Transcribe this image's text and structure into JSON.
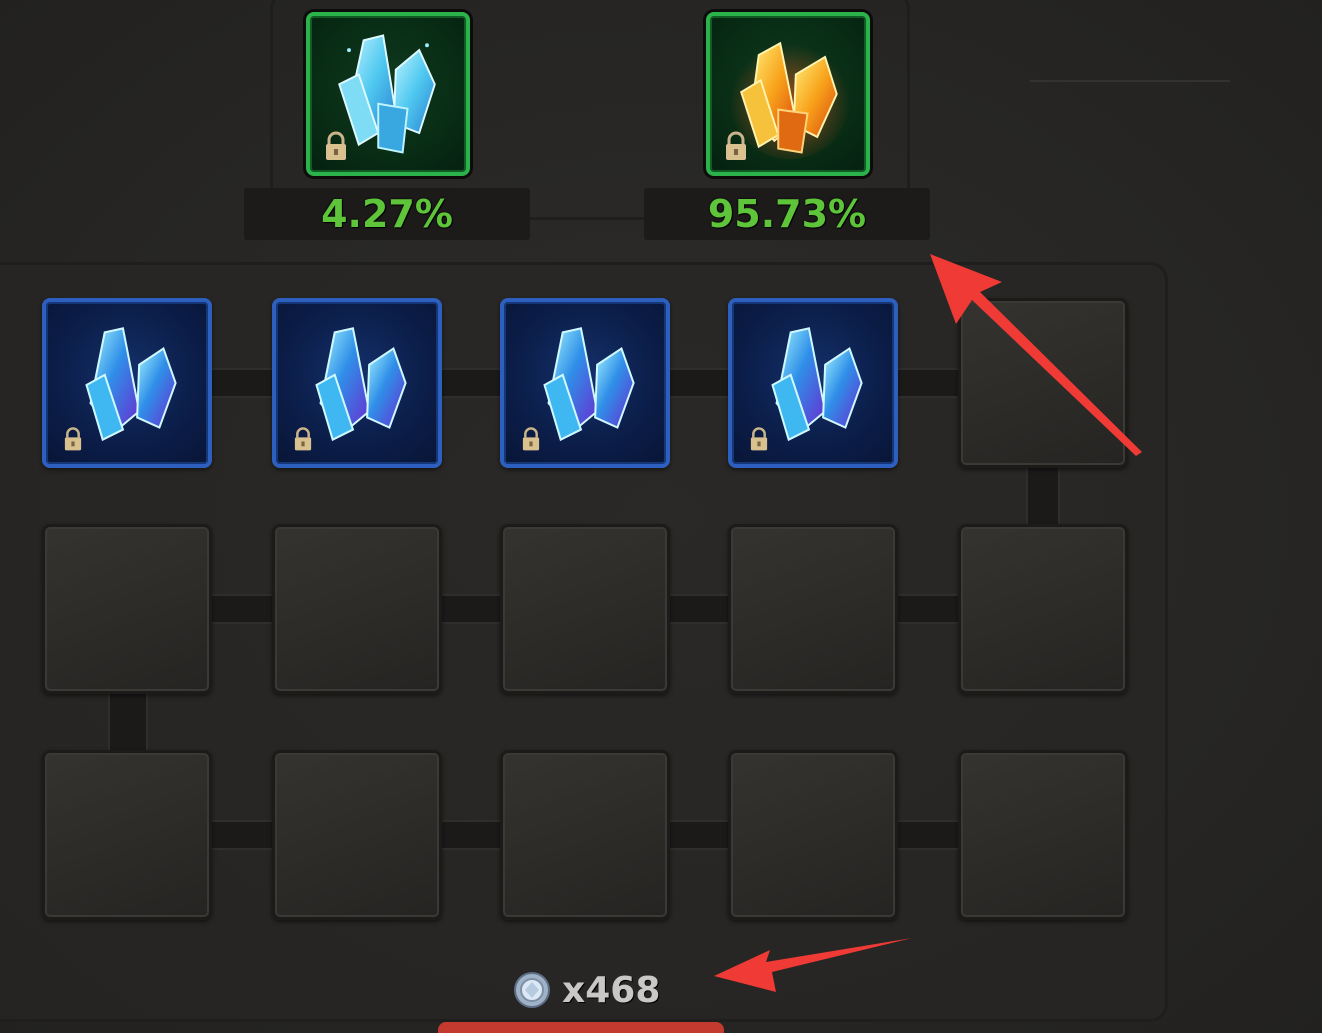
{
  "top_crystals": [
    {
      "name": "blue-green crystal",
      "chance": "4.27%",
      "locked": true
    },
    {
      "name": "orange crystal",
      "chance": "95.73%",
      "locked": true
    }
  ],
  "grid": {
    "rows": [
      [
        {
          "filled": true,
          "locked": true
        },
        {
          "filled": true,
          "locked": true
        },
        {
          "filled": true,
          "locked": true
        },
        {
          "filled": true,
          "locked": true
        },
        {
          "filled": false
        }
      ],
      [
        {
          "filled": false
        },
        {
          "filled": false
        },
        {
          "filled": false
        },
        {
          "filled": false
        },
        {
          "filled": false
        }
      ],
      [
        {
          "filled": false
        },
        {
          "filled": false
        },
        {
          "filled": false
        },
        {
          "filled": false
        },
        {
          "filled": false
        }
      ]
    ]
  },
  "currency": {
    "icon": "gem-coin-icon",
    "count": "x468"
  },
  "colors": {
    "chance_text": "#5ec43a",
    "annotation_arrow": "#ef3a35",
    "slot_blue_border": "#2d5fbf",
    "slot_green_border": "#2bb24a"
  }
}
